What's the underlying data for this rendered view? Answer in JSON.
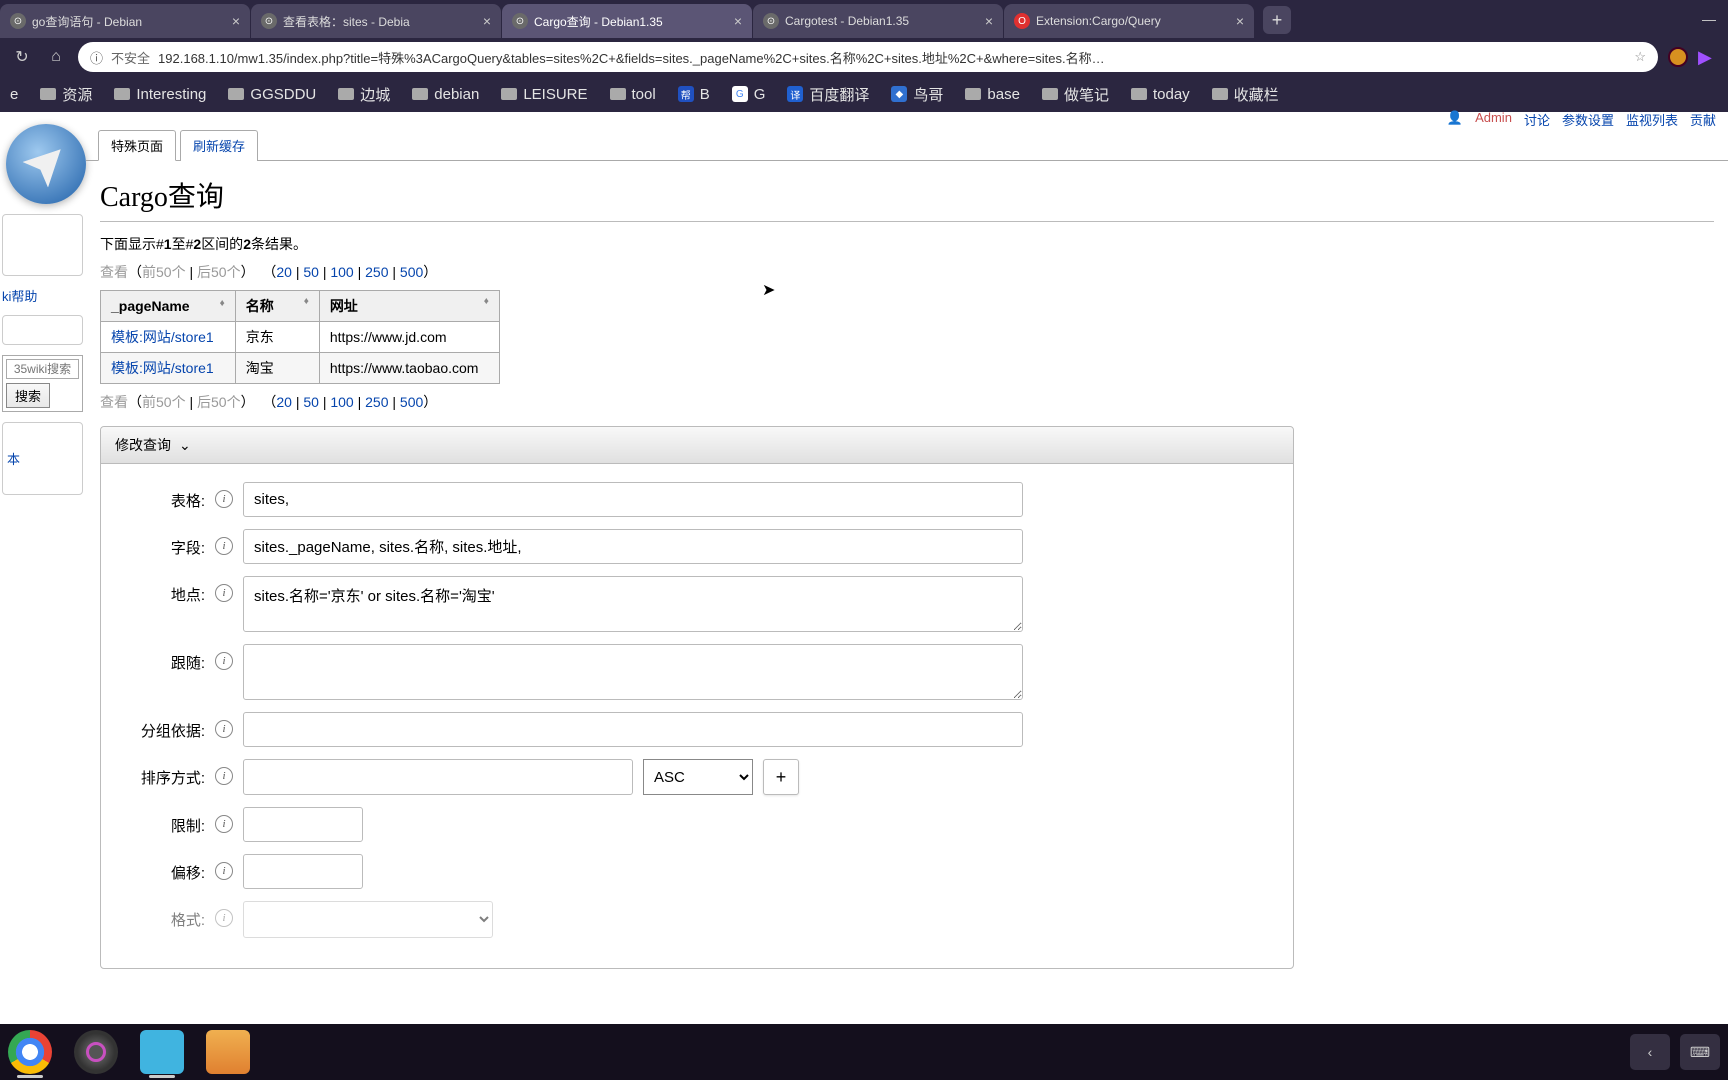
{
  "browser": {
    "tabs": [
      {
        "title": "go查询语句 - Debian",
        "active": false,
        "favicon": "globe"
      },
      {
        "title": "查看表格：sites - Debia",
        "active": false,
        "favicon": "globe"
      },
      {
        "title": "Cargo查询 - Debian1.35",
        "active": true,
        "favicon": "globe"
      },
      {
        "title": "Cargotest - Debian1.35",
        "active": false,
        "favicon": "globe"
      },
      {
        "title": "Extension:Cargo/Query",
        "active": false,
        "favicon": "opera"
      }
    ],
    "url_insecure": "不安全",
    "url": "192.168.1.10/mw1.35/index.php?title=特殊%3ACargoQuery&tables=sites%2C+&fields=sites._pageName%2C+sites.名称%2C+sites.地址%2C+&where=sites.名称…"
  },
  "bookmarks": [
    "e",
    "资源",
    "Interesting",
    "GGSDDU",
    "边城",
    "debian",
    "LEISURE",
    "tool",
    "B",
    "G",
    "百度翻译",
    "鸟哥",
    "base",
    "做笔记",
    "today",
    "收藏栏"
  ],
  "user_actions": {
    "admin": "Admin",
    "talk": "讨论",
    "params": "参数设置",
    "watch": "监视列表",
    "contrib": "贡献"
  },
  "sidebar": {
    "help": "ki帮助",
    "placeholder": "35wiki搜索",
    "search_btn": "搜索",
    "other": "本"
  },
  "page_tabs": {
    "special": "特殊页面",
    "refresh": "刷新缓存"
  },
  "title": "Cargo查询",
  "result_desc_parts": {
    "pre": "下面显示#",
    "n1": "1",
    "mid": "至#",
    "n2": "2",
    "between": "区间的",
    "count": "2",
    "suf": "条结果。"
  },
  "pager": {
    "view": "查看",
    "prev": "前50个",
    "next": "后50个",
    "n20": "20",
    "n50": "50",
    "n100": "100",
    "n250": "250",
    "n500": "500"
  },
  "table": {
    "headers": {
      "page": "_pageName",
      "name": "名称",
      "url": "网址"
    },
    "rows": [
      {
        "page": "模板:网站/store1",
        "name": "京东",
        "url": "https://www.jd.com"
      },
      {
        "page": "模板:网站/store1",
        "name": "淘宝",
        "url": "https://www.taobao.com"
      }
    ]
  },
  "form": {
    "header": "修改查询",
    "labels": {
      "tables": "表格:",
      "fields": "字段:",
      "where": "地点:",
      "join": "跟随:",
      "group": "分组依据:",
      "order": "排序方式:",
      "limit": "限制:",
      "offset": "偏移:",
      "format": "格式:"
    },
    "values": {
      "tables": "sites,",
      "fields": "sites._pageName, sites.名称, sites.地址,",
      "where": "sites.名称='京东' or sites.名称='淘宝'",
      "join": "",
      "group": "",
      "order_dir": "ASC",
      "limit": "",
      "offset": ""
    }
  }
}
